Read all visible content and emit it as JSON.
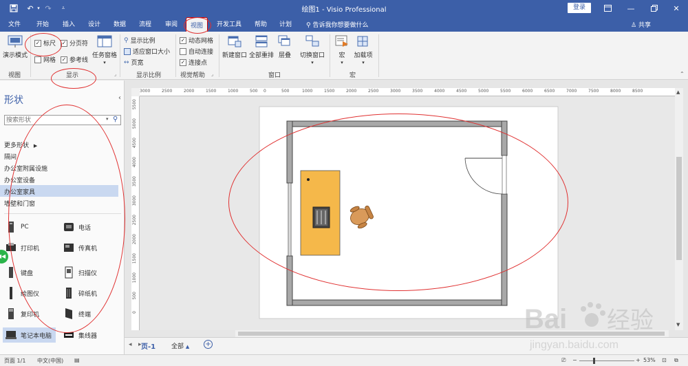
{
  "app": {
    "window_title": "绘图1 - Visio Professional",
    "login_label": "登录"
  },
  "tabs": [
    {
      "label": "文件"
    },
    {
      "label": "开始"
    },
    {
      "label": "插入"
    },
    {
      "label": "设计"
    },
    {
      "label": "数据"
    },
    {
      "label": "流程"
    },
    {
      "label": "审阅"
    },
    {
      "label": "视图"
    },
    {
      "label": "开发工具"
    },
    {
      "label": "帮助"
    },
    {
      "label": "计划"
    }
  ],
  "active_tab": "视图",
  "tell_me": "告诉我你想要做什么",
  "share": "共享",
  "ribbon": {
    "groups": {
      "view": "视图",
      "show": "显示",
      "zoom": "显示比例",
      "visual_aids": "视觉帮助",
      "window": "窗口",
      "macros": "宏"
    },
    "presentation_mode": "演示模式",
    "ruler": "标尺",
    "page_breaks": "分页符",
    "grid": "网格",
    "guides": "参考线",
    "task_panes": "任务窗格",
    "zoom_ratio": "显示比例",
    "fit_to_window": "适应窗口大小",
    "page_width": "页宽",
    "dynamic_grid": "动态网格",
    "autoconnect": "自动连接",
    "connection_points": "连接点",
    "new_window": "新建窗口",
    "arrange_all": "全部重排",
    "cascade": "层叠",
    "switch_windows": "切换窗口",
    "macros": "宏",
    "addons": "加载项",
    "checked": {
      "ruler": true,
      "page_breaks": true,
      "grid": false,
      "guides": true,
      "dynamic_grid": true,
      "autoconnect": false,
      "connection_points": true
    }
  },
  "shapes_panel": {
    "title": "形状",
    "search_placeholder": "搜索形状",
    "more_shapes": "更多形状",
    "stencils": [
      {
        "label": "隔间"
      },
      {
        "label": "办公室附属设施"
      },
      {
        "label": "办公室设备"
      },
      {
        "label": "办公室家具"
      },
      {
        "label": "墙壁和门窗"
      }
    ],
    "shapes": [
      {
        "label": "PC",
        "icon": "pc-icon"
      },
      {
        "label": "电话",
        "icon": "telephone-icon"
      },
      {
        "label": "打印机",
        "icon": "printer-icon"
      },
      {
        "label": "传真机",
        "icon": "fax-icon"
      },
      {
        "label": "键盘",
        "icon": "keyboard-icon"
      },
      {
        "label": "扫描仪",
        "icon": "scanner-icon"
      },
      {
        "label": "绘图仪",
        "icon": "plotter-icon"
      },
      {
        "label": "碎纸机",
        "icon": "shredder-icon"
      },
      {
        "label": "复印机",
        "icon": "copier-icon"
      },
      {
        "label": "终端",
        "icon": "terminal-icon"
      },
      {
        "label": "笔记本电脑",
        "icon": "laptop-icon"
      },
      {
        "label": "集线器",
        "icon": "hub-icon"
      }
    ]
  },
  "ruler_labels": [
    "3000",
    "2500",
    "2000",
    "1500",
    "1000",
    "500",
    "0",
    "500",
    "1000",
    "1500",
    "2000",
    "2500",
    "3000",
    "3500",
    "4000",
    "4500",
    "5000",
    "5500",
    "6000",
    "6500",
    "7000",
    "7500",
    "8000",
    "8500"
  ],
  "vruler_labels": [
    "5500",
    "5000",
    "4500",
    "4000",
    "3500",
    "3000",
    "2500",
    "2000",
    "1500",
    "1000",
    "500",
    "0"
  ],
  "page_tabs": {
    "current": "页-1",
    "all": "全部",
    "add": "+"
  },
  "status": {
    "page": "页面 1/1",
    "language": "中文(中国)",
    "zoom": "53%"
  },
  "watermark": {
    "brand": "Bai",
    "brand_cn": "经验",
    "url": "jingyan.baidu.com"
  }
}
